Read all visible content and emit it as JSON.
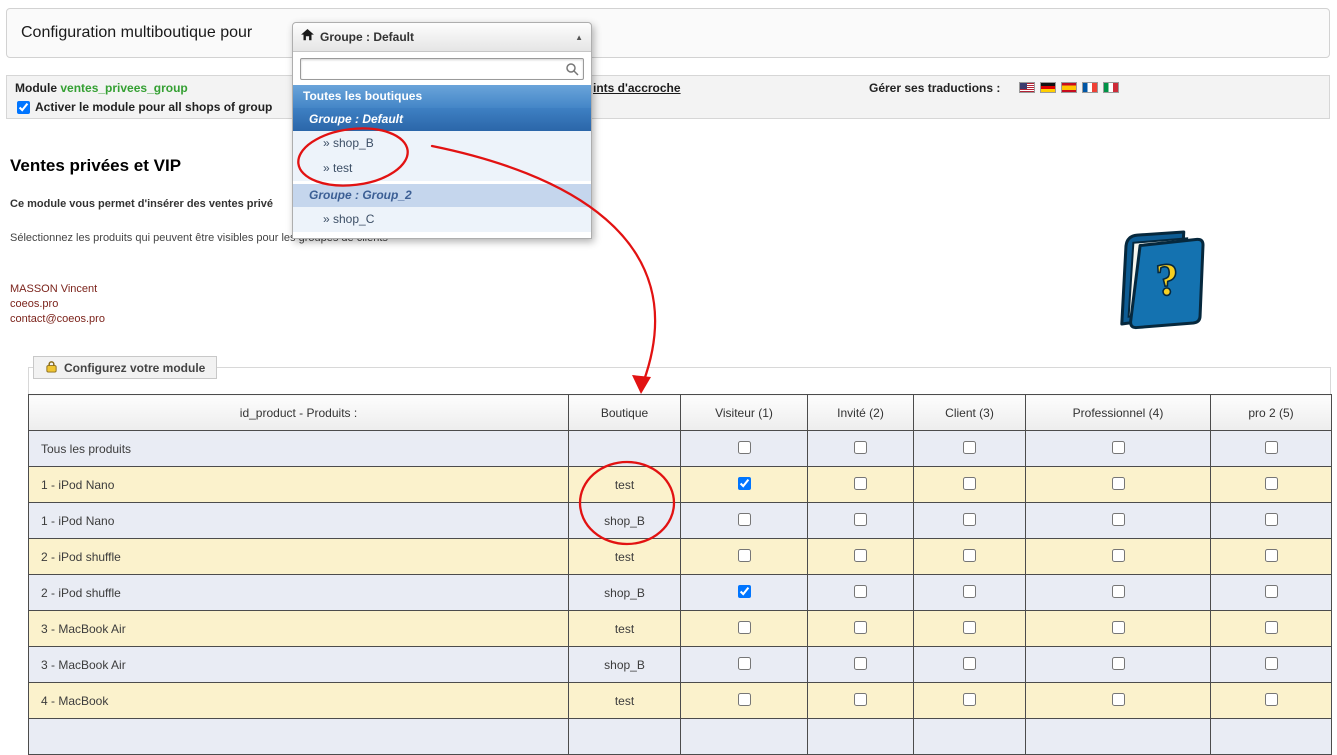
{
  "page": {
    "title_bar": "Configuration multiboutique pour"
  },
  "shop_selector": {
    "button_label": "Groupe : Default",
    "caret": "▲",
    "search_value": "",
    "options": [
      {
        "label": "Toutes les boutiques",
        "type": "all"
      },
      {
        "label": "Groupe : Default",
        "type": "group_selected"
      },
      {
        "label": "» shop_B",
        "type": "shop"
      },
      {
        "label": "» test",
        "type": "shop"
      },
      {
        "label": "Groupe : Group_2",
        "type": "group"
      },
      {
        "label": "» shop_C",
        "type": "shop"
      }
    ]
  },
  "module_bar": {
    "module_label": "Module",
    "module_name": "ventes_privees_group",
    "hook_link_fragment": "ints d'accroche",
    "translations_label": "Gérer ses traductions :",
    "flags": [
      "us",
      "de",
      "es",
      "fr",
      "it"
    ],
    "activate_label": "Activer le module pour all shops of group",
    "activate_checked": true
  },
  "intro": {
    "heading": "Ventes privées et VIP",
    "line1": "Ce module vous permet d'insérer des ventes privé",
    "line2": "Sélectionnez les produits qui peuvent être visibles pour les groupes de clients",
    "author_name": "MASSON Vincent",
    "author_site": "coeos.pro",
    "author_email": "contact@coeos.pro"
  },
  "config": {
    "legend": "Configurez votre module"
  },
  "table": {
    "headers": [
      "id_product - Produits :",
      "Boutique",
      "Visiteur (1)",
      "Invité (2)",
      "Client (3)",
      "Professionnel (4)",
      "pro 2 (5)"
    ],
    "rows": [
      {
        "product": "Tous les produits",
        "boutique": "",
        "checks": [
          false,
          false,
          false,
          false,
          false
        ]
      },
      {
        "product": "1 - iPod Nano",
        "boutique": "test",
        "checks": [
          true,
          false,
          false,
          false,
          false
        ]
      },
      {
        "product": "1 - iPod Nano",
        "boutique": "shop_B",
        "checks": [
          false,
          false,
          false,
          false,
          false
        ]
      },
      {
        "product": "2 - iPod shuffle",
        "boutique": "test",
        "checks": [
          false,
          false,
          false,
          false,
          false
        ]
      },
      {
        "product": "2 - iPod shuffle",
        "boutique": "shop_B",
        "checks": [
          true,
          false,
          false,
          false,
          false
        ]
      },
      {
        "product": "3 - MacBook Air",
        "boutique": "test",
        "checks": [
          false,
          false,
          false,
          false,
          false
        ]
      },
      {
        "product": "3 - MacBook Air",
        "boutique": "shop_B",
        "checks": [
          false,
          false,
          false,
          false,
          false
        ]
      },
      {
        "product": "4 - MacBook",
        "boutique": "test",
        "checks": [
          false,
          false,
          false,
          false,
          false
        ]
      },
      {
        "product": "",
        "boutique": "",
        "checks": [
          null,
          null,
          null,
          null,
          null
        ]
      }
    ]
  },
  "colors": {
    "module_name_green": "#35a033",
    "annotation_red": "#e21212",
    "row_yellow": "#fbf2cc",
    "row_blue": "#e9ecf4",
    "author_maroon": "#7c241c",
    "dropdown_blue": "#4486c7"
  }
}
